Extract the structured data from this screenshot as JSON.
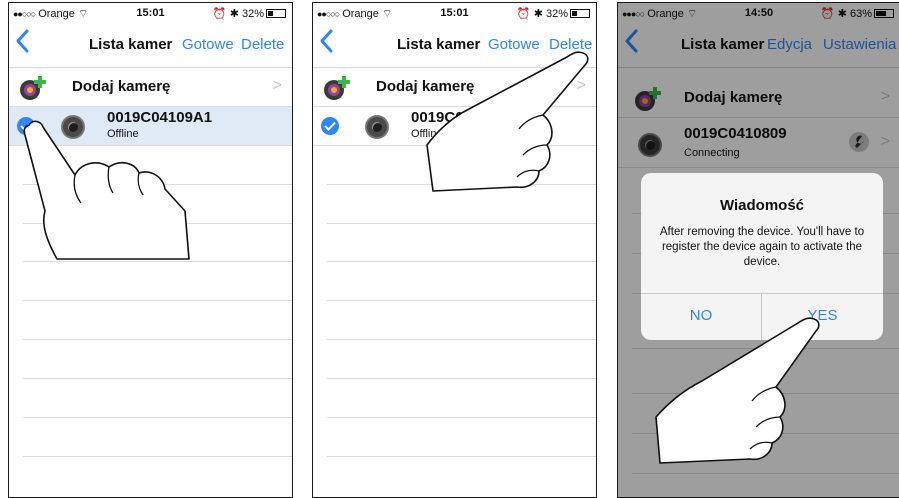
{
  "screens": [
    {
      "status": {
        "carrier": "Orange",
        "time": "15:01",
        "battery": "32%",
        "battery_level": 0.32
      },
      "nav": {
        "title": "Lista kamer",
        "done_label": "Gotowe",
        "delete_label": "Delete"
      },
      "add_camera_label": "Dodaj kamerę",
      "camera": {
        "name": "0019C04109A1",
        "status": "Offline",
        "selected": true
      }
    },
    {
      "status": {
        "carrier": "Orange",
        "time": "15:01",
        "battery": "32%",
        "battery_level": 0.32
      },
      "nav": {
        "title": "Lista kamer",
        "done_label": "Gotowe",
        "delete_label": "Delete"
      },
      "add_camera_label": "Dodaj kamerę",
      "camera": {
        "name": "0019C041",
        "status": "Offline",
        "selected": true
      }
    },
    {
      "status": {
        "carrier": "Orange",
        "time": "14:50",
        "battery": "63%",
        "battery_level": 0.63
      },
      "nav": {
        "title": "Lista kamer",
        "edit_label": "Edycja",
        "settings_label": "Ustawienia"
      },
      "add_camera_label": "Dodaj kamerę",
      "camera": {
        "name": "0019C0410809",
        "status": "Connecting"
      },
      "dialog": {
        "title": "Wiadomość",
        "message": "After removing the device. You'll have to register the device again to activate the device.",
        "no_label": "NO",
        "yes_label": "YES"
      }
    }
  ],
  "icons": {
    "back": "chevron-left-icon",
    "add_camera": "camera-plus-icon",
    "camera": "camera-lens-icon",
    "settings": "wrench-icon",
    "hand": "pointing-hand-icon"
  },
  "colors": {
    "accent": "#2f86f7",
    "selected_row": "#dfeaf6"
  }
}
